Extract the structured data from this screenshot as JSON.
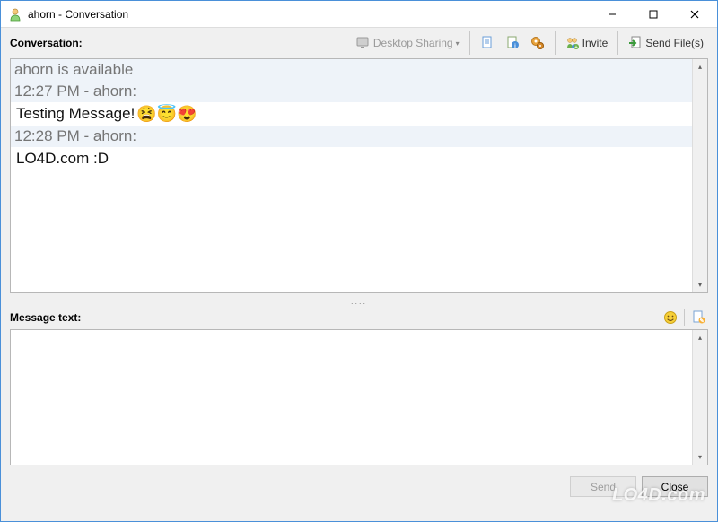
{
  "titlebar": {
    "title": "ahorn - Conversation"
  },
  "toolbar": {
    "conversation_label": "Conversation:",
    "desktop_sharing": "Desktop Sharing",
    "invite": "Invite",
    "send_files": "Send File(s)"
  },
  "conversation": {
    "status_line": "ahorn is available",
    "msg1_time": "12:27 PM - ahorn:",
    "msg1_text": "Testing Message! ",
    "msg1_emojis": "😫😇😍",
    "msg2_time": "12:28 PM - ahorn:",
    "msg2_text": "LO4D.com :D"
  },
  "input": {
    "label": "Message text:",
    "value": ""
  },
  "buttons": {
    "send": "Send",
    "close": "Close"
  },
  "watermark": "LO4D.com"
}
